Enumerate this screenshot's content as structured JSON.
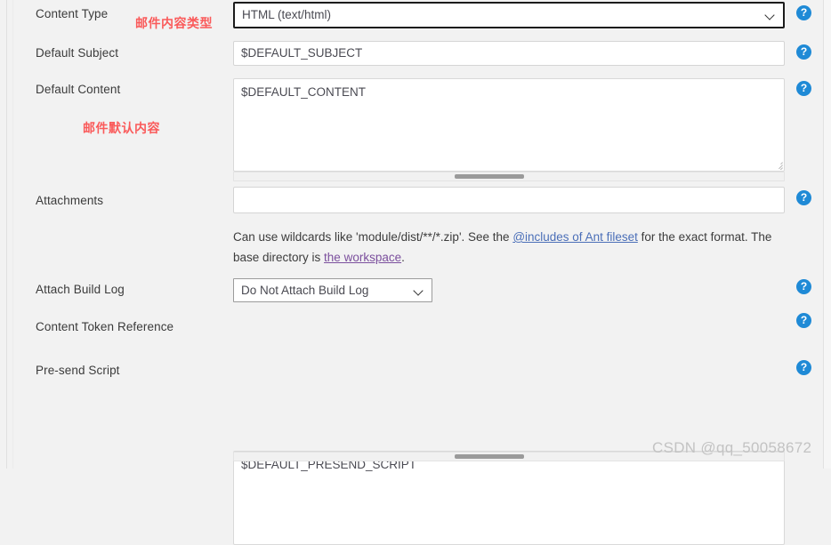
{
  "form": {
    "rows": [
      {
        "key": "content_type",
        "label": "Content Type",
        "control": "select",
        "value": "HTML (text/html)",
        "help": "?"
      },
      {
        "key": "default_subject",
        "label": "Default Subject",
        "control": "input",
        "value": "$DEFAULT_SUBJECT",
        "help": "?"
      },
      {
        "key": "default_content",
        "label": "Default Content",
        "control": "textarea",
        "value": "$DEFAULT_CONTENT",
        "help": "?"
      },
      {
        "key": "attachments",
        "label": "Attachments",
        "control": "input",
        "value": "",
        "help": "?"
      },
      {
        "key": "attach_build_log",
        "label": "Attach Build Log",
        "control": "select",
        "value": "Do Not Attach Build Log",
        "help": "?"
      },
      {
        "key": "content_token_reference",
        "label": "Content Token Reference",
        "control": "none",
        "value": "",
        "help": "?"
      },
      {
        "key": "pre_send_script",
        "label": "Pre-send Script",
        "control": "textarea",
        "value": "$DEFAULT_PRESEND_SCRIPT",
        "help": "?"
      }
    ],
    "attachments_description": {
      "part1": "Can use wildcards like 'module/dist/**/*.zip'. See the ",
      "link1": "@includes of Ant fileset",
      "part2": " for the exact format. The base directory is ",
      "link2": "the workspace",
      "part3": "."
    }
  },
  "annotations": [
    {
      "text": "邮件内容类型",
      "color": "#fa5a5a"
    },
    {
      "text": "邮件默认内容",
      "color": "#fa5a5a"
    }
  ],
  "watermark": "CSDN @qq_50058672",
  "colors": {
    "background": "#f2f2f2",
    "help_icon": "#1f8ad6",
    "annotation": "#fa5a5a",
    "link_unvisited": "#4b6fb8",
    "link_visited": "#7b4f9d",
    "focus_border": "#1c1c1c"
  }
}
